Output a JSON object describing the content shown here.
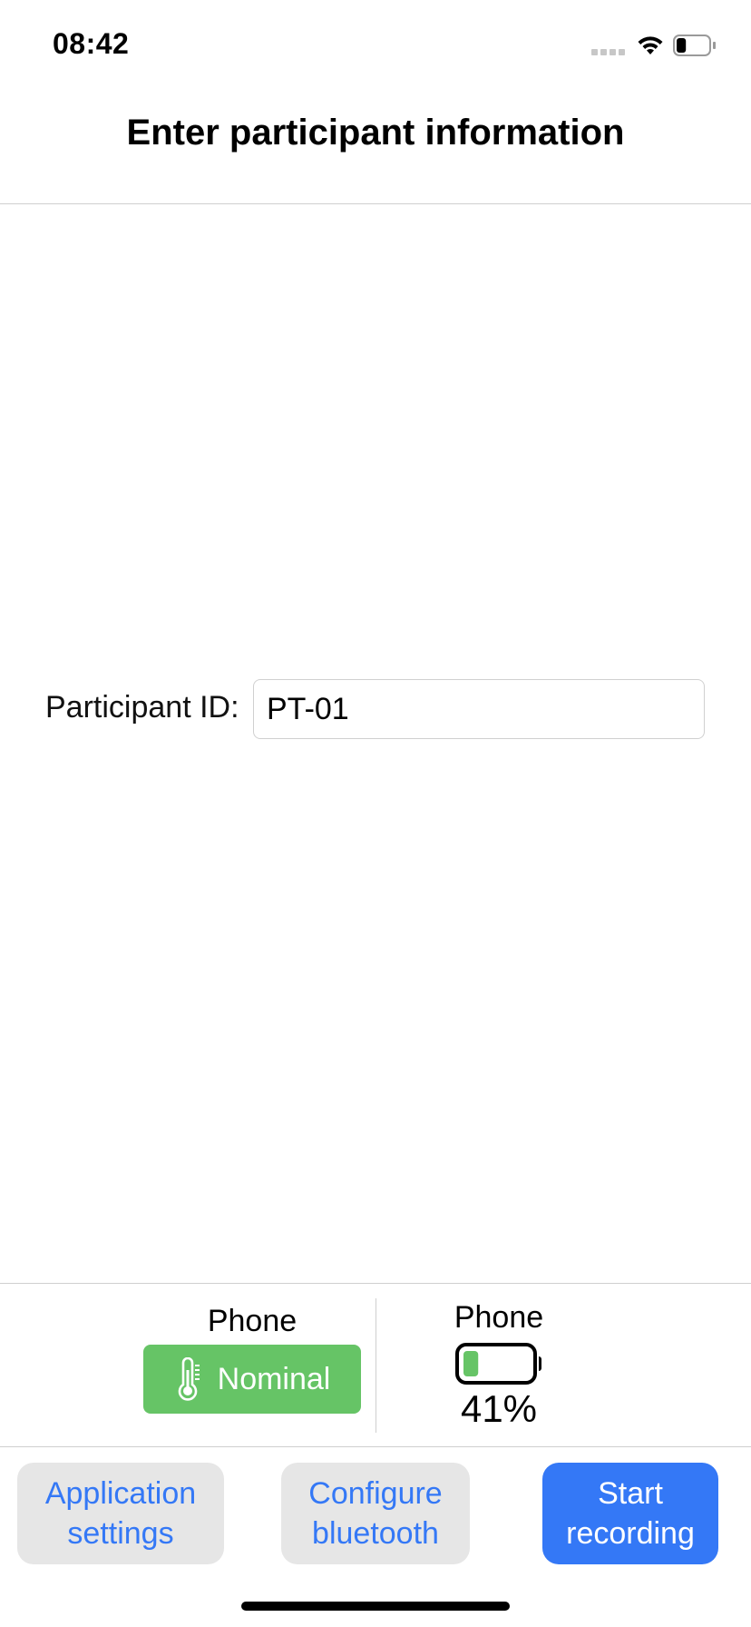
{
  "status_bar": {
    "time": "08:42",
    "signal_icon": "cellular-dots-icon",
    "wifi_icon": "wifi-icon",
    "battery_icon": "battery-icon",
    "battery_level": 0.3
  },
  "header": {
    "title": "Enter participant information"
  },
  "form": {
    "participant_label": "Participant ID:",
    "participant_value": "PT-01"
  },
  "status_panel": {
    "thermal": {
      "label": "Phone",
      "state": "Nominal",
      "icon": "thermometer-icon",
      "color": "#66c466"
    },
    "battery": {
      "label": "Phone",
      "percent_text": "41%",
      "level": 0.41,
      "icon": "battery-icon",
      "fill_color": "#66c466"
    }
  },
  "actions": {
    "app_settings_label": "Application\nsettings",
    "bluetooth_label": "Configure\nbluetooth",
    "start_label": "Start\nrecording",
    "accent_color": "#3478f6"
  }
}
